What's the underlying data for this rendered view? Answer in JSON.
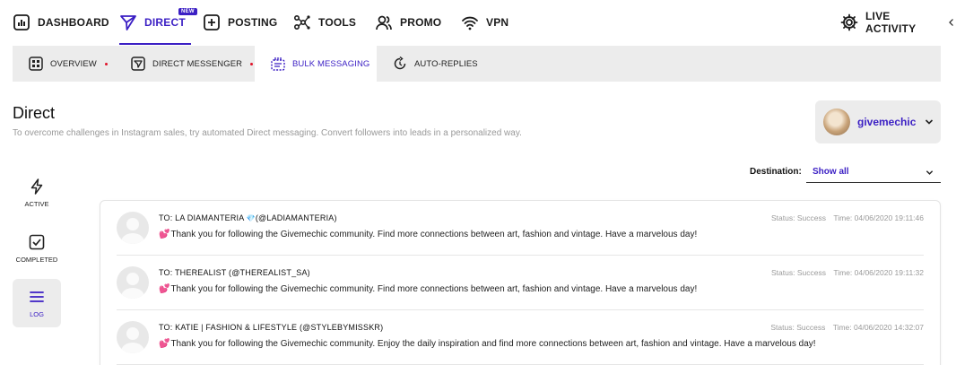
{
  "topnav": {
    "items": [
      {
        "label": "DASHBOARD",
        "icon": "dashboard-icon"
      },
      {
        "label": "DIRECT",
        "icon": "paper-plane-icon",
        "badge": "NEW",
        "active": true
      },
      {
        "label": "POSTING",
        "icon": "plus-square-icon"
      },
      {
        "label": "TOOLS",
        "icon": "nodes-icon"
      },
      {
        "label": "PROMO",
        "icon": "users-icon"
      },
      {
        "label": "VPN",
        "icon": "wifi-icon"
      }
    ],
    "live_activity": "LIVE ACTIVITY"
  },
  "subnav": {
    "items": [
      {
        "label": "OVERVIEW",
        "icon": "grid-icon",
        "dot": true
      },
      {
        "label": "DIRECT MESSENGER",
        "icon": "send-box-icon",
        "dot": true
      },
      {
        "label": "BULK MESSAGING",
        "icon": "bulk-icon",
        "active": true
      },
      {
        "label": "AUTO-REPLIES",
        "icon": "auto-reply-icon"
      }
    ]
  },
  "page": {
    "title": "Direct",
    "description": "To overcome challenges in Instagram sales, try automated Direct messaging. Convert followers into leads in a personalized way."
  },
  "account": {
    "name": "givemechic"
  },
  "destination": {
    "label": "Destination:",
    "value": "Show all"
  },
  "sidenav": {
    "items": [
      {
        "label": "ACTIVE",
        "icon": "bolt-icon"
      },
      {
        "label": "COMPLETED",
        "icon": "check-square-icon"
      },
      {
        "label": "LOG",
        "icon": "menu-icon",
        "active": true
      }
    ]
  },
  "log": [
    {
      "to_prefix": "TO: LA DIAMANTERIA",
      "to_emoji": "💎",
      "to_suffix": "(@LADIAMANTERIA)",
      "message": "Thank you for following the Givemechic community. Find more connections between art, fashion and vintage. Have a marvelous day!",
      "status": "Status: Success",
      "time": "Time: 04/06/2020 19:11:46"
    },
    {
      "to_prefix": "TO: THEREALIST (@THEREALIST_SA)",
      "to_emoji": "",
      "to_suffix": "",
      "message": "Thank you for following the Givemechic community. Find more connections between art, fashion and vintage. Have a marvelous day!",
      "status": "Status: Success",
      "time": "Time: 04/06/2020 19:11:32"
    },
    {
      "to_prefix": "TO: KATIE | FASHION & LIFESTYLE (@STYLEBYMISSKR)",
      "to_emoji": "",
      "to_suffix": "",
      "message": "Thank you for following the Givemechic community. Enjoy the daily inspiration and find more connections between art, fashion and vintage. Have a marvelous day!",
      "status": "Status: Success",
      "time": "Time: 04/06/2020 14:32:07"
    }
  ],
  "message_emoji": "💕",
  "colors": {
    "accent": "#3b1fc4",
    "dot": "#e0142a",
    "panel": "#ececec"
  }
}
